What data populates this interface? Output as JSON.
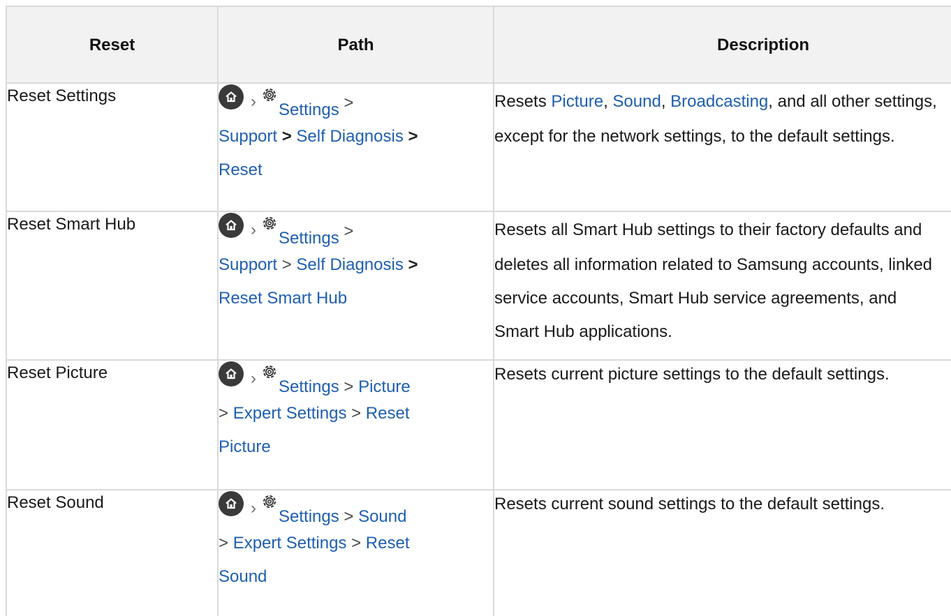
{
  "headers": {
    "reset": "Reset",
    "path": "Path",
    "description": "Description"
  },
  "sep": ">",
  "rows": [
    {
      "reset": "Reset Settings",
      "path": {
        "settings": "Settings",
        "l2a": "Support",
        "l2b": "Self Diagnosis",
        "l3": "Reset"
      },
      "desc": {
        "pre": "Resets ",
        "link1": "Picture",
        "c1": ", ",
        "link2": "Sound",
        "c2": ", ",
        "link3": "Broadcasting",
        "post1": ", and all other settings,",
        "line2": "except for the network settings, to the default settings."
      }
    },
    {
      "reset": "Reset Smart Hub",
      "path": {
        "settings": "Settings",
        "l2a": "Support",
        "l2b": "Self Diagnosis",
        "l3": "Reset Smart Hub"
      },
      "desc": {
        "lines": [
          "Resets all Smart Hub settings to their factory defaults and",
          "deletes all information related to Samsung accounts, linked",
          "service accounts, Smart Hub service agreements, and",
          "Smart Hub applications."
        ]
      }
    },
    {
      "reset": "Reset Picture",
      "path": {
        "settings": "Settings",
        "l1b": "Picture",
        "l2a": "Expert Settings",
        "l2b": "Reset",
        "l3": "Picture"
      },
      "desc": {
        "line1": "Resets current picture settings to the default settings."
      }
    },
    {
      "reset": "Reset Sound",
      "path": {
        "settings": "Settings",
        "l1b": "Sound",
        "l2a": "Expert Settings",
        "l2b": "Reset",
        "l3": "Sound"
      },
      "desc": {
        "line1": "Resets current sound settings to the default settings."
      }
    }
  ],
  "icons": {
    "home": "home-icon",
    "chevron": "chevron-right-icon",
    "gear": "gear-icon"
  },
  "colors": {
    "link": "#1f5fb0",
    "header_bg": "#f2f2f2",
    "border": "#d9d9d9",
    "home_icon_bg": "#3a3a3a"
  }
}
